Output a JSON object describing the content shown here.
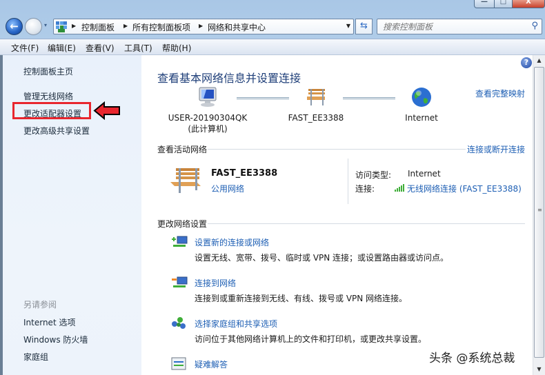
{
  "window": {
    "controls": {
      "minimize": "—",
      "maximize": "□",
      "close": "X"
    }
  },
  "nav": {
    "back_icon": "arrow-left-icon",
    "forward_icon": "arrow-right-icon",
    "recent_icon": "▾",
    "breadcrumb": [
      "控制面板",
      "所有控制面板项",
      "网络和共享中心"
    ],
    "refresh_icon": "⇆",
    "search_placeholder": "搜索控制面板",
    "search_icon": "⚲"
  },
  "menubar": {
    "items": [
      "文件(F)",
      "编辑(E)",
      "查看(V)",
      "工具(T)",
      "帮助(H)"
    ]
  },
  "sidebar": {
    "home": "控制面板主页",
    "links": [
      "管理无线网络",
      "更改适配器设置",
      "更改高级共享设置"
    ],
    "highlighted": "更改适配器设置",
    "see_also_heading": "另请参阅",
    "see_also": [
      "Internet 选项",
      "Windows 防火墙",
      "家庭组"
    ]
  },
  "main": {
    "help_icon": "?",
    "title": "查看基本网络信息并设置连接",
    "view_full_map": "查看完整映射",
    "map_nodes": [
      {
        "name": "USER-20190304QK",
        "sub": "(此计算机)",
        "icon": "computer-icon"
      },
      {
        "name": "FAST_EE3388",
        "sub": "",
        "icon": "bench-icon"
      },
      {
        "name": "Internet",
        "sub": "",
        "icon": "globe-icon"
      }
    ],
    "active_networks": {
      "heading": "查看活动网络",
      "connect_disconnect": "连接或断开连接",
      "network_name": "FAST_EE3388",
      "network_type": "公用网络",
      "access_type_label": "访问类型:",
      "access_type_value": "Internet",
      "connection_label": "连接:",
      "connection_value": "无线网络连接 (FAST_EE3388)"
    },
    "change_settings": {
      "heading": "更改网络设置",
      "tasks": [
        {
          "title": "设置新的连接或网络",
          "desc": "设置无线、宽带、拨号、临时或 VPN 连接；或设置路由器或访问点。"
        },
        {
          "title": "连接到网络",
          "desc": "连接到或重新连接到无线、有线、拨号或 VPN 网络连接。"
        },
        {
          "title": "选择家庭组和共享选项",
          "desc": "访问位于其他网络计算机上的文件和打印机，或更改共享设置。"
        },
        {
          "title": "疑难解答",
          "desc": ""
        }
      ]
    }
  },
  "watermark": "头条 @系统总裁",
  "colors": {
    "link": "#1e5fb4",
    "title": "#1f3f79",
    "highlight": "#e8262e"
  }
}
